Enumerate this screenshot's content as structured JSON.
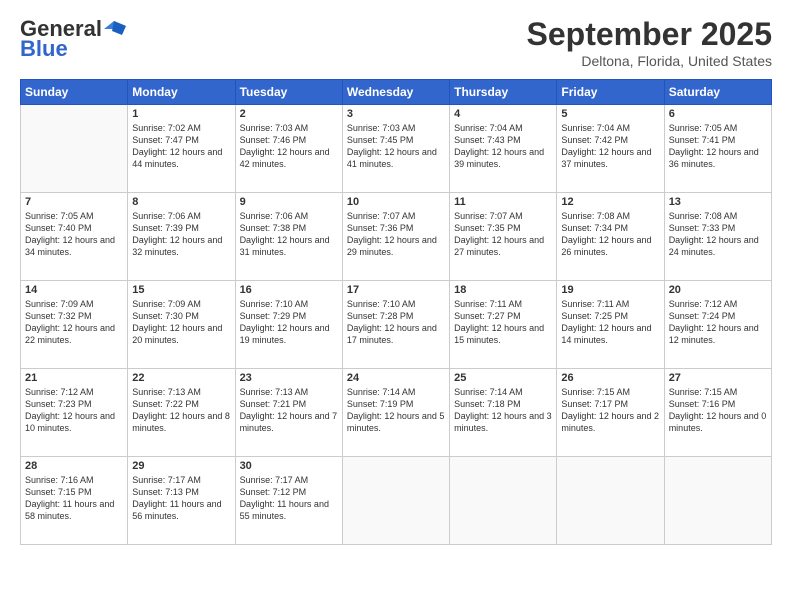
{
  "header": {
    "logo_general": "General",
    "logo_blue": "Blue",
    "month_title": "September 2025",
    "location": "Deltona, Florida, United States"
  },
  "days_of_week": [
    "Sunday",
    "Monday",
    "Tuesday",
    "Wednesday",
    "Thursday",
    "Friday",
    "Saturday"
  ],
  "weeks": [
    [
      {
        "day": "",
        "empty": true
      },
      {
        "day": "1",
        "sunrise": "7:02 AM",
        "sunset": "7:47 PM",
        "daylight": "12 hours and 44 minutes."
      },
      {
        "day": "2",
        "sunrise": "7:03 AM",
        "sunset": "7:46 PM",
        "daylight": "12 hours and 42 minutes."
      },
      {
        "day": "3",
        "sunrise": "7:03 AM",
        "sunset": "7:45 PM",
        "daylight": "12 hours and 41 minutes."
      },
      {
        "day": "4",
        "sunrise": "7:04 AM",
        "sunset": "7:43 PM",
        "daylight": "12 hours and 39 minutes."
      },
      {
        "day": "5",
        "sunrise": "7:04 AM",
        "sunset": "7:42 PM",
        "daylight": "12 hours and 37 minutes."
      },
      {
        "day": "6",
        "sunrise": "7:05 AM",
        "sunset": "7:41 PM",
        "daylight": "12 hours and 36 minutes."
      }
    ],
    [
      {
        "day": "7",
        "sunrise": "7:05 AM",
        "sunset": "7:40 PM",
        "daylight": "12 hours and 34 minutes."
      },
      {
        "day": "8",
        "sunrise": "7:06 AM",
        "sunset": "7:39 PM",
        "daylight": "12 hours and 32 minutes."
      },
      {
        "day": "9",
        "sunrise": "7:06 AM",
        "sunset": "7:38 PM",
        "daylight": "12 hours and 31 minutes."
      },
      {
        "day": "10",
        "sunrise": "7:07 AM",
        "sunset": "7:36 PM",
        "daylight": "12 hours and 29 minutes."
      },
      {
        "day": "11",
        "sunrise": "7:07 AM",
        "sunset": "7:35 PM",
        "daylight": "12 hours and 27 minutes."
      },
      {
        "day": "12",
        "sunrise": "7:08 AM",
        "sunset": "7:34 PM",
        "daylight": "12 hours and 26 minutes."
      },
      {
        "day": "13",
        "sunrise": "7:08 AM",
        "sunset": "7:33 PM",
        "daylight": "12 hours and 24 minutes."
      }
    ],
    [
      {
        "day": "14",
        "sunrise": "7:09 AM",
        "sunset": "7:32 PM",
        "daylight": "12 hours and 22 minutes."
      },
      {
        "day": "15",
        "sunrise": "7:09 AM",
        "sunset": "7:30 PM",
        "daylight": "12 hours and 20 minutes."
      },
      {
        "day": "16",
        "sunrise": "7:10 AM",
        "sunset": "7:29 PM",
        "daylight": "12 hours and 19 minutes."
      },
      {
        "day": "17",
        "sunrise": "7:10 AM",
        "sunset": "7:28 PM",
        "daylight": "12 hours and 17 minutes."
      },
      {
        "day": "18",
        "sunrise": "7:11 AM",
        "sunset": "7:27 PM",
        "daylight": "12 hours and 15 minutes."
      },
      {
        "day": "19",
        "sunrise": "7:11 AM",
        "sunset": "7:25 PM",
        "daylight": "12 hours and 14 minutes."
      },
      {
        "day": "20",
        "sunrise": "7:12 AM",
        "sunset": "7:24 PM",
        "daylight": "12 hours and 12 minutes."
      }
    ],
    [
      {
        "day": "21",
        "sunrise": "7:12 AM",
        "sunset": "7:23 PM",
        "daylight": "12 hours and 10 minutes."
      },
      {
        "day": "22",
        "sunrise": "7:13 AM",
        "sunset": "7:22 PM",
        "daylight": "12 hours and 8 minutes."
      },
      {
        "day": "23",
        "sunrise": "7:13 AM",
        "sunset": "7:21 PM",
        "daylight": "12 hours and 7 minutes."
      },
      {
        "day": "24",
        "sunrise": "7:14 AM",
        "sunset": "7:19 PM",
        "daylight": "12 hours and 5 minutes."
      },
      {
        "day": "25",
        "sunrise": "7:14 AM",
        "sunset": "7:18 PM",
        "daylight": "12 hours and 3 minutes."
      },
      {
        "day": "26",
        "sunrise": "7:15 AM",
        "sunset": "7:17 PM",
        "daylight": "12 hours and 2 minutes."
      },
      {
        "day": "27",
        "sunrise": "7:15 AM",
        "sunset": "7:16 PM",
        "daylight": "12 hours and 0 minutes."
      }
    ],
    [
      {
        "day": "28",
        "sunrise": "7:16 AM",
        "sunset": "7:15 PM",
        "daylight": "11 hours and 58 minutes."
      },
      {
        "day": "29",
        "sunrise": "7:17 AM",
        "sunset": "7:13 PM",
        "daylight": "11 hours and 56 minutes."
      },
      {
        "day": "30",
        "sunrise": "7:17 AM",
        "sunset": "7:12 PM",
        "daylight": "11 hours and 55 minutes."
      },
      {
        "day": "",
        "empty": true
      },
      {
        "day": "",
        "empty": true
      },
      {
        "day": "",
        "empty": true
      },
      {
        "day": "",
        "empty": true
      }
    ]
  ]
}
